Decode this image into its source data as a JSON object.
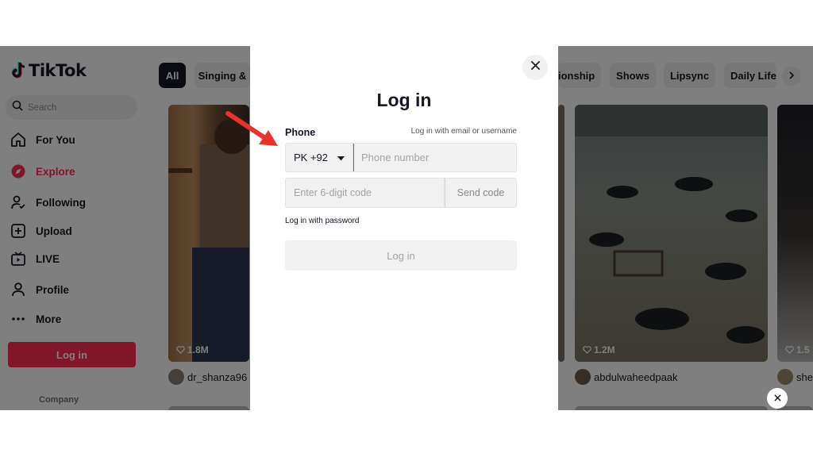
{
  "brand": {
    "name": "TikTok",
    "accent": "#fe2c55"
  },
  "search": {
    "placeholder": "Search"
  },
  "sidebar": {
    "items": [
      {
        "label": "For You",
        "icon": "home-icon"
      },
      {
        "label": "Explore",
        "icon": "compass-icon",
        "active": true
      },
      {
        "label": "Following",
        "icon": "following-icon"
      },
      {
        "label": "Upload",
        "icon": "upload-icon"
      },
      {
        "label": "LIVE",
        "icon": "live-icon"
      },
      {
        "label": "Profile",
        "icon": "profile-icon"
      },
      {
        "label": "More",
        "icon": "more-icon"
      }
    ],
    "login_label": "Log in",
    "company_label": "Company"
  },
  "categories": [
    "All",
    "Singing &",
    "ionship",
    "Shows",
    "Lipsync",
    "Daily Life"
  ],
  "feed": {
    "cards": [
      {
        "likes": "1.8M",
        "author": "dr_shanza96"
      },
      {
        "likes": "1.2M",
        "author": "abdulwaheedpaak"
      },
      {
        "likes": "1.5",
        "author": "she"
      }
    ]
  },
  "modal": {
    "title": "Log in",
    "phone_label": "Phone",
    "alt_login_link": "Log in with email or username",
    "country_code": "PK +92",
    "phone_placeholder": "Phone number",
    "code_placeholder": "Enter 6-digit code",
    "send_code_label": "Send code",
    "password_link": "Log in with password",
    "login_button": "Log in"
  }
}
